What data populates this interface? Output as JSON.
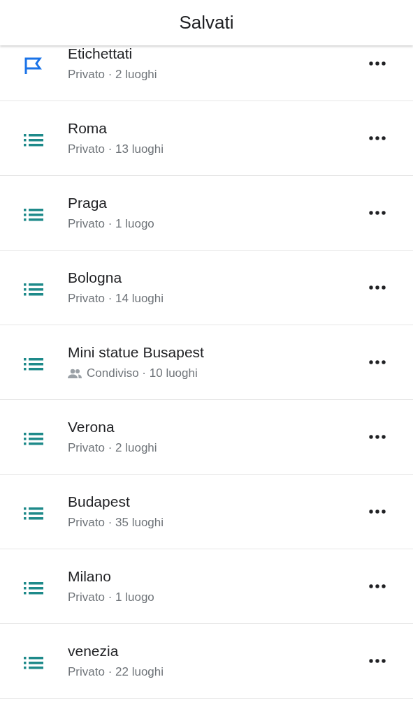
{
  "header": {
    "title": "Salvati"
  },
  "lists": [
    {
      "kind": "label",
      "name": "Etichettati",
      "shared": false,
      "subtitle": "Privato · 2 luoghi"
    },
    {
      "kind": "list",
      "name": "Roma",
      "shared": false,
      "subtitle": "Privato · 13 luoghi"
    },
    {
      "kind": "list",
      "name": "Praga",
      "shared": false,
      "subtitle": "Privato · 1 luogo"
    },
    {
      "kind": "list",
      "name": "Bologna",
      "shared": false,
      "subtitle": "Privato · 14 luoghi"
    },
    {
      "kind": "list",
      "name": "Mini statue Busapest",
      "shared": true,
      "subtitle": "Condiviso · 10 luoghi"
    },
    {
      "kind": "list",
      "name": "Verona",
      "shared": false,
      "subtitle": "Privato · 2 luoghi"
    },
    {
      "kind": "list",
      "name": "Budapest",
      "shared": false,
      "subtitle": "Privato · 35 luoghi"
    },
    {
      "kind": "list",
      "name": "Milano",
      "shared": false,
      "subtitle": "Privato · 1 luogo"
    },
    {
      "kind": "list",
      "name": "venezia",
      "shared": false,
      "subtitle": "Privato · 22 luoghi"
    }
  ]
}
